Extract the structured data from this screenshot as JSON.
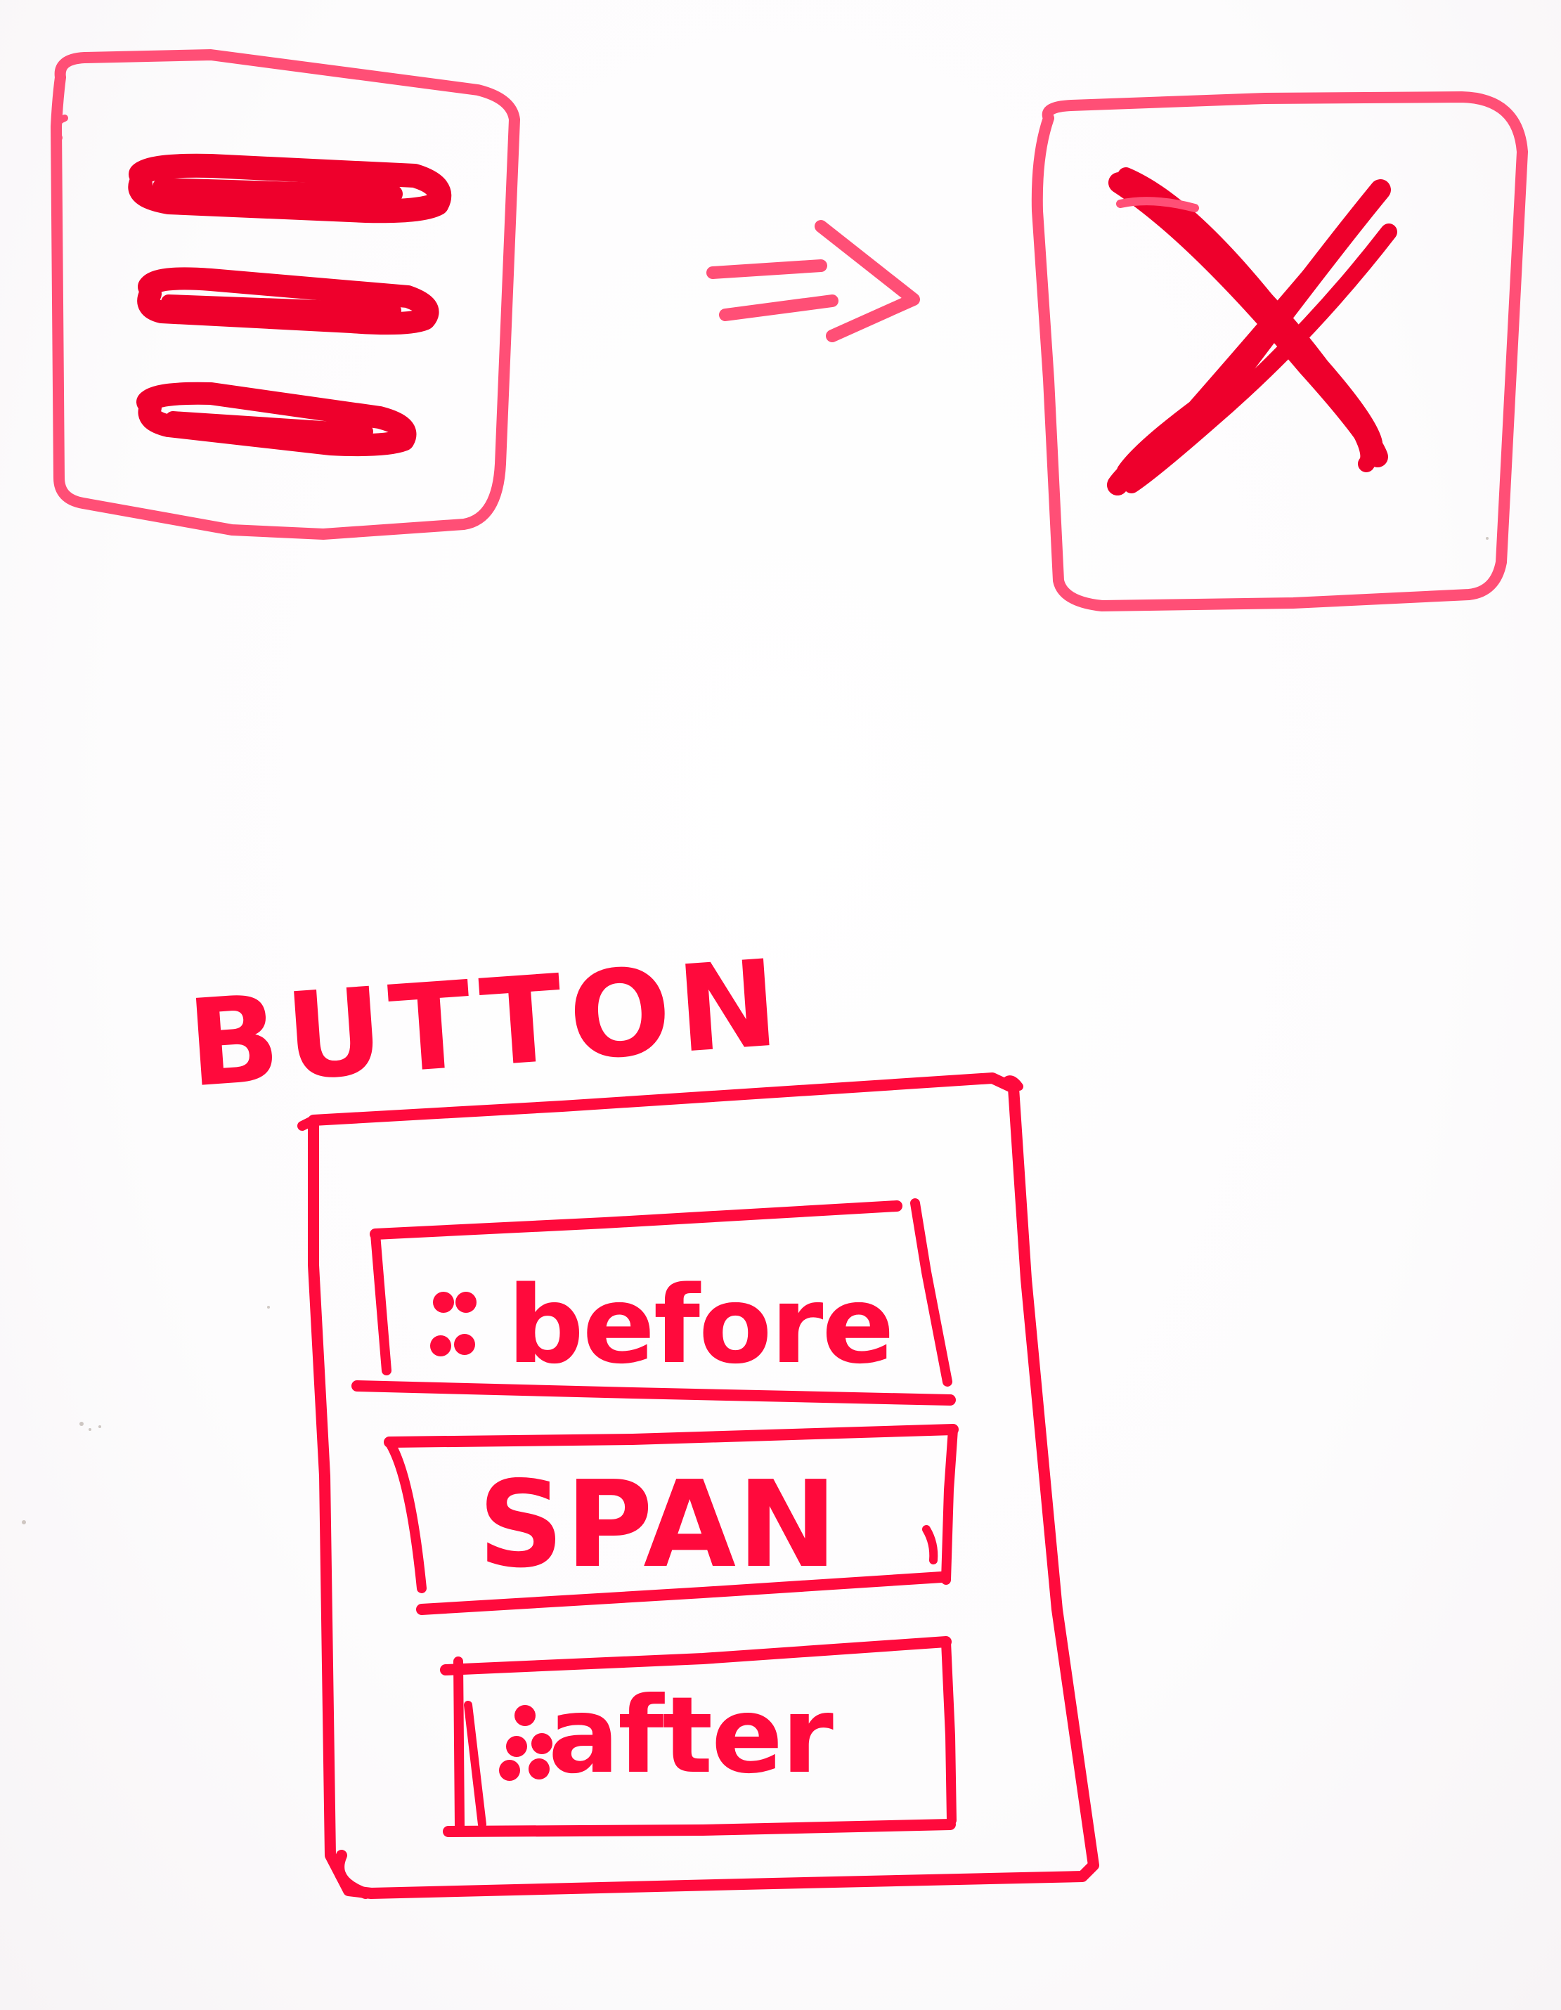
{
  "colors": {
    "ink": "#ff0a3c",
    "ink_light": "#ff4f76",
    "ink_dark": "#ee002c"
  },
  "top_row": {
    "left_icon": "hamburger-menu-icon",
    "arrow_icon": "double-arrow-right-icon",
    "right_icon": "close-x-icon"
  },
  "button_diagram": {
    "title": "BUTTON",
    "layers": [
      {
        "label": "before",
        "prefix": "::"
      },
      {
        "label": "SPAN",
        "prefix": ""
      },
      {
        "label": "after",
        "prefix": "::"
      }
    ]
  }
}
